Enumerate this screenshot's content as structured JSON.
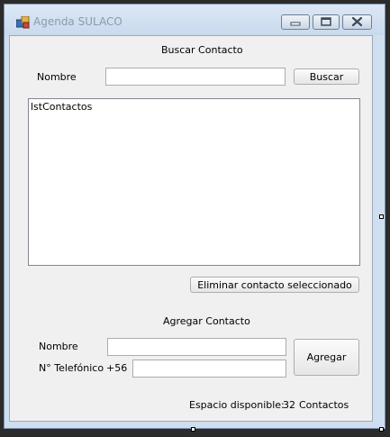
{
  "window": {
    "title": "Agenda SULACO",
    "icon": "app-form-icon",
    "controls": {
      "minimize": "minimize-icon",
      "maximize": "maximize-icon",
      "close": "close-icon"
    }
  },
  "search": {
    "heading": "Buscar Contacto",
    "name_label": "Nombre",
    "name_value": "",
    "button_label": "Buscar"
  },
  "contacts_list": {
    "name": "lstContactos",
    "items": []
  },
  "delete_button_label": "Eliminar contacto seleccionado",
  "add": {
    "heading": "Agregar Contacto",
    "name_label": "Nombre",
    "name_value": "",
    "phone_label": "N° Telefónico",
    "phone_prefix": "+56",
    "phone_value": "",
    "button_label": "Agregar"
  },
  "status": {
    "label": "Espacio disponible:",
    "count": "32",
    "unit": "Contactos"
  }
}
